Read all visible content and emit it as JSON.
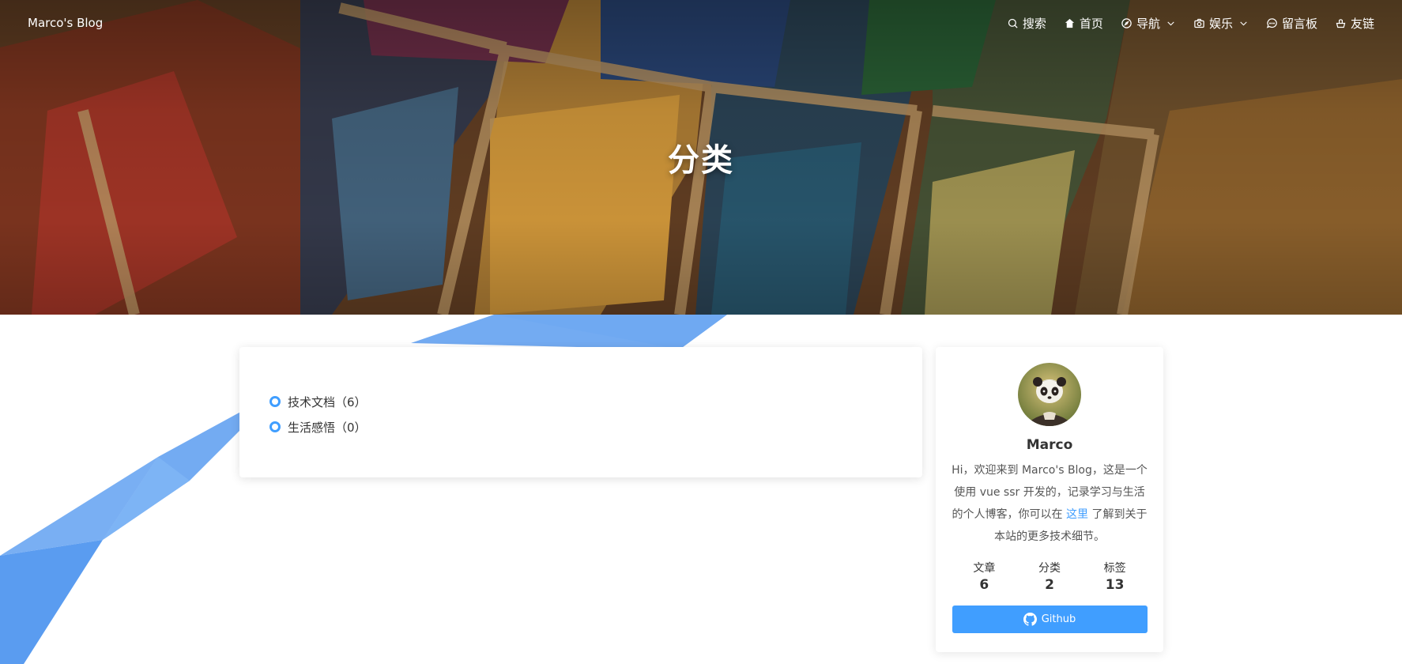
{
  "navbar": {
    "brand": "Marco's Blog",
    "items": [
      {
        "label": "搜索",
        "icon": "search-icon"
      },
      {
        "label": "首页",
        "icon": "home-icon"
      },
      {
        "label": "导航",
        "icon": "compass-icon",
        "dropdown": true
      },
      {
        "label": "娱乐",
        "icon": "camera-icon",
        "dropdown": true
      },
      {
        "label": "留言板",
        "icon": "message-icon"
      },
      {
        "label": "友链",
        "icon": "link-icon"
      }
    ]
  },
  "hero": {
    "title": "分类"
  },
  "categories": [
    {
      "label": "技术文档（6）"
    },
    {
      "label": "生活感悟（0）"
    }
  ],
  "profile": {
    "name": "Marco",
    "bio_before": "Hi，欢迎来到 Marco's Blog，这是一个使用 vue ssr 开发的，记录学习与生活的个人博客，你可以在 ",
    "bio_link": "这里",
    "bio_after": " 了解到关于本站的更多技术细节。",
    "stats": [
      {
        "label": "文章",
        "value": "6"
      },
      {
        "label": "分类",
        "value": "2"
      },
      {
        "label": "标签",
        "value": "13"
      }
    ],
    "github_label": "Github"
  },
  "colors": {
    "accent": "#409eff",
    "ribbon": "#5a9cf0"
  }
}
